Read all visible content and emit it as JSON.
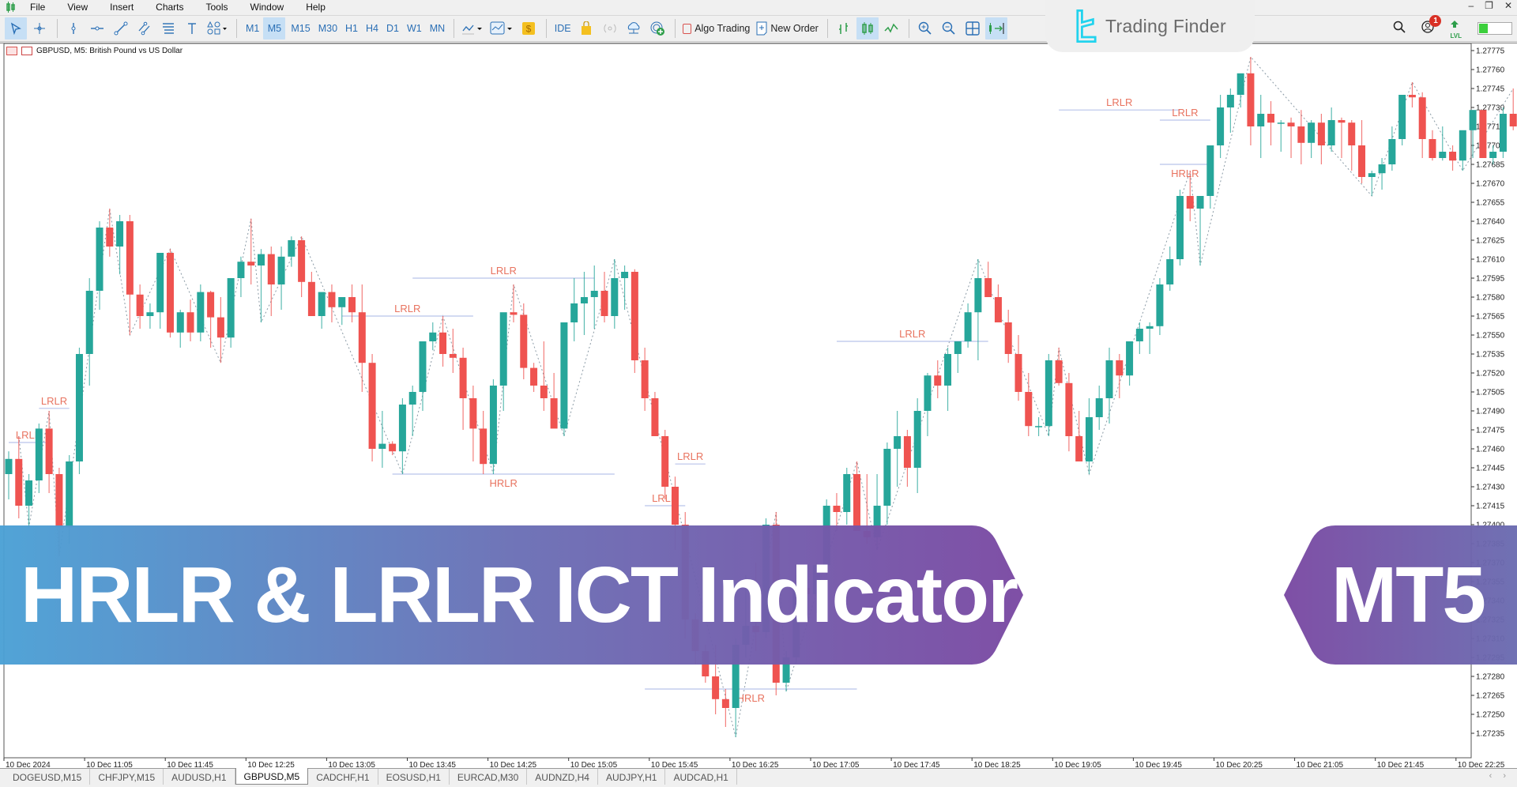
{
  "menu": {
    "items": [
      "File",
      "View",
      "Insert",
      "Charts",
      "Tools",
      "Window",
      "Help"
    ]
  },
  "window_controls": {
    "minimize": "–",
    "restore": "❐",
    "close": "✕"
  },
  "toolbar": {
    "timeframes": [
      "M1",
      "M5",
      "M15",
      "M30",
      "H1",
      "H4",
      "D1",
      "W1",
      "MN"
    ],
    "active_timeframe": "M5",
    "ide_label": "IDE",
    "algo_trading_label": "Algo Trading",
    "new_order_label": "New Order"
  },
  "brand": {
    "name": "Trading Finder",
    "accent": "#22d3ee"
  },
  "notifications": {
    "count": "1"
  },
  "level": {
    "label": "LVL",
    "fill_fraction": 0.25,
    "fill_color": "#3ccf3c"
  },
  "chart": {
    "title": "GBPUSD, M5:  British Pound vs US Dollar",
    "bull_color": "#26a69a",
    "bear_color": "#ef5350",
    "label_color": "#e8735f",
    "level_line_color": "#b9c3ea"
  },
  "banner": {
    "title": "HRLR & LRLR ICT Indicator",
    "platform": "MT5",
    "gradient_start": "#4aa0d5",
    "gradient_end": "#7b4aa3"
  },
  "tabs": [
    {
      "label": "DOGEUSD,M15"
    },
    {
      "label": "CHFJPY,M15"
    },
    {
      "label": "AUDUSD,H1"
    },
    {
      "label": "GBPUSD,M5",
      "active": true
    },
    {
      "label": "CADCHF,H1"
    },
    {
      "label": "EOSUSD,H1"
    },
    {
      "label": "EURCAD,M30"
    },
    {
      "label": "AUDNZD,H4"
    },
    {
      "label": "AUDJPY,H1"
    },
    {
      "label": "AUDCAD,H1"
    }
  ],
  "chart_data": {
    "type": "candlestick",
    "symbol": "GBPUSD",
    "timeframe": "M5",
    "title": "GBPUSD, M5:  British Pound vs US Dollar",
    "ylim": [
      1.27225,
      1.27785
    ],
    "y_ticks": [
      "1.27775",
      "1.27760",
      "1.27745",
      "1.27730",
      "1.27715",
      "1.27700",
      "1.27685",
      "1.27670",
      "1.27655",
      "1.27640",
      "1.27625",
      "1.27610",
      "1.27595",
      "1.27580",
      "1.27565",
      "1.27550",
      "1.27535",
      "1.27520",
      "1.27505",
      "1.27490",
      "1.27475",
      "1.27460",
      "1.27445",
      "1.27430",
      "1.27415",
      "1.27400",
      "1.27385",
      "1.27370",
      "1.27355",
      "1.27340",
      "1.27325",
      "1.27310",
      "1.27295",
      "1.27280",
      "1.27265",
      "1.27250",
      "1.27235"
    ],
    "x_ticks": [
      "10 Dec 2024",
      "10 Dec 11:05",
      "10 Dec 11:45",
      "10 Dec 12:25",
      "10 Dec 13:05",
      "10 Dec 13:45",
      "10 Dec 14:25",
      "10 Dec 15:05",
      "10 Dec 15:45",
      "10 Dec 16:25",
      "10 Dec 17:05",
      "10 Dec 17:45",
      "10 Dec 18:25",
      "10 Dec 19:05",
      "10 Dec 19:45",
      "10 Dec 20:25",
      "10 Dec 21:05",
      "10 Dec 21:45",
      "10 Dec 22:25"
    ],
    "bars_per_tick": 8,
    "ohlc": [
      [
        1.2744,
        1.27458,
        1.2742,
        1.27452
      ],
      [
        1.27452,
        1.2747,
        1.27405,
        1.27415
      ],
      [
        1.27415,
        1.2744,
        1.27398,
        1.27435
      ],
      [
        1.27435,
        1.2748,
        1.27425,
        1.27476
      ],
      [
        1.27476,
        1.2749,
        1.27425,
        1.2744
      ],
      [
        1.2744,
        1.27445,
        1.27375,
        1.27398
      ],
      [
        1.27398,
        1.27455,
        1.27385,
        1.2745
      ],
      [
        1.2745,
        1.2754,
        1.2744,
        1.27535
      ],
      [
        1.27535,
        1.27595,
        1.2751,
        1.27585
      ],
      [
        1.27585,
        1.2764,
        1.2757,
        1.27635
      ],
      [
        1.27635,
        1.2765,
        1.27612,
        1.2762
      ],
      [
        1.2762,
        1.27645,
        1.27598,
        1.2764
      ],
      [
        1.2764,
        1.27645,
        1.2755,
        1.27582
      ],
      [
        1.27582,
        1.2759,
        1.27555,
        1.27565
      ],
      [
        1.27565,
        1.27575,
        1.27555,
        1.27568
      ],
      [
        1.27568,
        1.27615,
        1.27555,
        1.27615
      ],
      [
        1.27615,
        1.27618,
        1.27548,
        1.27552
      ],
      [
        1.27552,
        1.2757,
        1.2754,
        1.27568
      ],
      [
        1.27568,
        1.27578,
        1.27545,
        1.27552
      ],
      [
        1.27552,
        1.2759,
        1.27545,
        1.27584
      ],
      [
        1.27584,
        1.27585,
        1.2754,
        1.27564
      ],
      [
        1.27564,
        1.2758,
        1.27528,
        1.27548
      ],
      [
        1.27548,
        1.27595,
        1.2754,
        1.27595
      ],
      [
        1.27595,
        1.27612,
        1.2758,
        1.27608
      ],
      [
        1.27608,
        1.27642,
        1.2759,
        1.27605
      ],
      [
        1.27605,
        1.27618,
        1.2756,
        1.27614
      ],
      [
        1.27614,
        1.2762,
        1.27565,
        1.2759
      ],
      [
        1.2759,
        1.2762,
        1.2757,
        1.27612
      ],
      [
        1.27612,
        1.27628,
        1.27604,
        1.27625
      ],
      [
        1.27625,
        1.27628,
        1.2758,
        1.27592
      ],
      [
        1.27592,
        1.276,
        1.27565,
        1.27565
      ],
      [
        1.27565,
        1.2758,
        1.27555,
        1.27584
      ],
      [
        1.27584,
        1.2759,
        1.2756,
        1.27572
      ],
      [
        1.27572,
        1.2758,
        1.27558,
        1.2758
      ],
      [
        1.2758,
        1.2759,
        1.2756,
        1.27568
      ],
      [
        1.27568,
        1.2759,
        1.27505,
        1.27528
      ],
      [
        1.27528,
        1.27535,
        1.2745,
        1.2746
      ],
      [
        1.2746,
        1.2749,
        1.27445,
        1.27464
      ],
      [
        1.27464,
        1.27466,
        1.27455,
        1.27458
      ],
      [
        1.27458,
        1.275,
        1.2744,
        1.27495
      ],
      [
        1.27495,
        1.2751,
        1.2747,
        1.27505
      ],
      [
        1.27505,
        1.27545,
        1.2749,
        1.27545
      ],
      [
        1.27545,
        1.2756,
        1.27538,
        1.27552
      ],
      [
        1.27552,
        1.27565,
        1.27525,
        1.27535
      ],
      [
        1.27535,
        1.27555,
        1.2752,
        1.27532
      ],
      [
        1.27532,
        1.2754,
        1.27475,
        1.275
      ],
      [
        1.275,
        1.2751,
        1.2745,
        1.27476
      ],
      [
        1.27476,
        1.2749,
        1.2744,
        1.27448
      ],
      [
        1.27448,
        1.27515,
        1.2744,
        1.2751
      ],
      [
        1.2751,
        1.2756,
        1.2749,
        1.27568
      ],
      [
        1.27568,
        1.2759,
        1.2756,
        1.27566
      ],
      [
        1.27566,
        1.27575,
        1.27515,
        1.27524
      ],
      [
        1.27524,
        1.27528,
        1.27505,
        1.2751
      ],
      [
        1.2751,
        1.27545,
        1.2749,
        1.275
      ],
      [
        1.275,
        1.2752,
        1.2748,
        1.27476
      ],
      [
        1.27476,
        1.2751,
        1.2747,
        1.2756
      ],
      [
        1.2756,
        1.27595,
        1.27545,
        1.27575
      ],
      [
        1.27575,
        1.276,
        1.2755,
        1.2758
      ],
      [
        1.2758,
        1.27605,
        1.27555,
        1.27585
      ],
      [
        1.27585,
        1.276,
        1.2756,
        1.27565
      ],
      [
        1.27565,
        1.2761,
        1.27555,
        1.27595
      ],
      [
        1.27595,
        1.27605,
        1.2757,
        1.276
      ],
      [
        1.276,
        1.27602,
        1.2752,
        1.2753
      ],
      [
        1.2753,
        1.2754,
        1.2749,
        1.275
      ],
      [
        1.275,
        1.27505,
        1.2748,
        1.2747
      ],
      [
        1.2747,
        1.27475,
        1.2742,
        1.2743
      ],
      [
        1.2743,
        1.27438,
        1.2738,
        1.274
      ],
      [
        1.274,
        1.2741,
        1.2731,
        1.27325
      ],
      [
        1.27325,
        1.2733,
        1.2729,
        1.273
      ],
      [
        1.273,
        1.27305,
        1.27275,
        1.2728
      ],
      [
        1.2728,
        1.27305,
        1.2725,
        1.27262
      ],
      [
        1.27262,
        1.2727,
        1.2724,
        1.27255
      ],
      [
        1.27255,
        1.2731,
        1.27232,
        1.27305
      ],
      [
        1.27305,
        1.2736,
        1.27295,
        1.2732
      ],
      [
        1.2732,
        1.2737,
        1.273,
        1.27315
      ],
      [
        1.27315,
        1.27405,
        1.2731,
        1.274
      ],
      [
        1.274,
        1.2741,
        1.27265,
        1.27275
      ],
      [
        1.27275,
        1.273,
        1.27268,
        1.27295
      ],
      [
        1.27295,
        1.2736,
        1.2729,
        1.2735
      ],
      [
        1.2735,
        1.2736,
        1.27335,
        1.27345
      ],
      [
        1.27345,
        1.2737,
        1.2733,
        1.27368
      ],
      [
        1.27368,
        1.2742,
        1.2736,
        1.27415
      ],
      [
        1.27415,
        1.27425,
        1.27395,
        1.2741
      ],
      [
        1.2741,
        1.27445,
        1.274,
        1.2744
      ],
      [
        1.2744,
        1.2745,
        1.27395,
        1.27395
      ],
      [
        1.27395,
        1.2744,
        1.27385,
        1.2739
      ],
      [
        1.2739,
        1.2744,
        1.2738,
        1.27415
      ],
      [
        1.27415,
        1.27465,
        1.274,
        1.2746
      ],
      [
        1.2746,
        1.2749,
        1.2743,
        1.2747
      ],
      [
        1.2747,
        1.27475,
        1.2743,
        1.27445
      ],
      [
        1.27445,
        1.275,
        1.27425,
        1.2749
      ],
      [
        1.2749,
        1.2752,
        1.2747,
        1.27518
      ],
      [
        1.27518,
        1.2753,
        1.275,
        1.2751
      ],
      [
        1.2751,
        1.2754,
        1.2749,
        1.27535
      ],
      [
        1.27535,
        1.2754,
        1.2752,
        1.27545
      ],
      [
        1.27545,
        1.27575,
        1.2754,
        1.27568
      ],
      [
        1.27568,
        1.2761,
        1.2753,
        1.27595
      ],
      [
        1.27595,
        1.27608,
        1.27585,
        1.2758
      ],
      [
        1.2758,
        1.2759,
        1.2756,
        1.2756
      ],
      [
        1.2756,
        1.2757,
        1.27528,
        1.27535
      ],
      [
        1.27535,
        1.2755,
        1.27498,
        1.27505
      ],
      [
        1.27505,
        1.2752,
        1.2747,
        1.27478
      ],
      [
        1.27478,
        1.27485,
        1.2747,
        1.27478
      ],
      [
        1.27478,
        1.27535,
        1.2747,
        1.2753
      ],
      [
        1.2753,
        1.2754,
        1.2751,
        1.27512
      ],
      [
        1.27512,
        1.2752,
        1.27458,
        1.2747
      ],
      [
        1.2747,
        1.2749,
        1.2745,
        1.2745
      ],
      [
        1.2745,
        1.275,
        1.2744,
        1.27485
      ],
      [
        1.27485,
        1.2751,
        1.27475,
        1.275
      ],
      [
        1.275,
        1.2754,
        1.2748,
        1.2753
      ],
      [
        1.2753,
        1.27535,
        1.275,
        1.27518
      ],
      [
        1.27518,
        1.27545,
        1.2751,
        1.27545
      ],
      [
        1.27545,
        1.2756,
        1.27535,
        1.27555
      ],
      [
        1.27555,
        1.2756,
        1.27535,
        1.27557
      ],
      [
        1.27557,
        1.27595,
        1.2755,
        1.2759
      ],
      [
        1.2759,
        1.2762,
        1.27585,
        1.2761
      ],
      [
        1.2761,
        1.27665,
        1.27605,
        1.2766
      ],
      [
        1.2766,
        1.2768,
        1.2764,
        1.2765
      ],
      [
        1.2765,
        1.2766,
        1.27605,
        1.2766
      ],
      [
        1.2766,
        1.277,
        1.2765,
        1.277
      ],
      [
        1.277,
        1.2774,
        1.2769,
        1.2773
      ],
      [
        1.2773,
        1.27745,
        1.2771,
        1.2774
      ],
      [
        1.2774,
        1.27755,
        1.2773,
        1.27757
      ],
      [
        1.27757,
        1.2777,
        1.277,
        1.27715
      ],
      [
        1.27715,
        1.2774,
        1.2769,
        1.27725
      ],
      [
        1.27725,
        1.27735,
        1.277,
        1.27718
      ],
      [
        1.27718,
        1.2772,
        1.27695,
        1.27718
      ],
      [
        1.27718,
        1.27722,
        1.2769,
        1.27715
      ],
      [
        1.27715,
        1.27728,
        1.27685,
        1.27702
      ],
      [
        1.27702,
        1.2772,
        1.2769,
        1.27718
      ],
      [
        1.27718,
        1.27725,
        1.27685,
        1.277
      ],
      [
        1.277,
        1.2773,
        1.27695,
        1.2772
      ],
      [
        1.2772,
        1.27722,
        1.2769,
        1.27718
      ],
      [
        1.27718,
        1.2772,
        1.2768,
        1.277
      ],
      [
        1.277,
        1.2772,
        1.2767,
        1.27675
      ],
      [
        1.27675,
        1.2768,
        1.2766,
        1.27678
      ],
      [
        1.27678,
        1.2769,
        1.27665,
        1.27685
      ],
      [
        1.27685,
        1.27715,
        1.2768,
        1.27705
      ],
      [
        1.27705,
        1.2774,
        1.277,
        1.2774
      ],
      [
        1.2774,
        1.2775,
        1.2773,
        1.27738
      ],
      [
        1.27738,
        1.27742,
        1.2769,
        1.27705
      ],
      [
        1.27705,
        1.27712,
        1.27688,
        1.2769
      ],
      [
        1.2769,
        1.27715,
        1.27688,
        1.27695
      ],
      [
        1.27695,
        1.277,
        1.2768,
        1.27688
      ],
      [
        1.27688,
        1.277,
        1.2768,
        1.27712
      ],
      [
        1.27712,
        1.27728,
        1.2769,
        1.27728
      ],
      [
        1.27728,
        1.27728,
        1.2769,
        1.2769
      ],
      [
        1.2769,
        1.277,
        1.27685,
        1.27695
      ],
      [
        1.27695,
        1.2773,
        1.2769,
        1.27725
      ],
      [
        1.27725,
        1.27745,
        1.27712,
        1.27715
      ]
    ],
    "annotations": [
      {
        "text": "LRLR",
        "bar_start": 0,
        "bar_end": 4,
        "price": 1.27465
      },
      {
        "text": "LRLR",
        "bar_start": 3,
        "bar_end": 6,
        "price": 1.27492
      },
      {
        "text": "LRLR",
        "bar_start": 33,
        "bar_end": 46,
        "price": 1.27565
      },
      {
        "text": "LRLR",
        "bar_start": 40,
        "bar_end": 58,
        "price": 1.27595
      },
      {
        "text": "HRLR",
        "bar_start": 38,
        "bar_end": 60,
        "price": 1.2744
      },
      {
        "text": "LRLR",
        "bar_start": 63,
        "bar_end": 67,
        "price": 1.27415
      },
      {
        "text": "LRLR",
        "bar_start": 66,
        "bar_end": 69,
        "price": 1.27448
      },
      {
        "text": "HRLR",
        "bar_start": 63,
        "bar_end": 84,
        "price": 1.2727
      },
      {
        "text": "LRLR",
        "bar_start": 82,
        "bar_end": 97,
        "price": 1.27545
      },
      {
        "text": "LRLR",
        "bar_start": 104,
        "bar_end": 116,
        "price": 1.27728
      },
      {
        "text": "LRLR",
        "bar_start": 114,
        "bar_end": 119,
        "price": 1.2772
      },
      {
        "text": "HRLR",
        "bar_start": 114,
        "bar_end": 119,
        "price": 1.27685
      }
    ]
  }
}
